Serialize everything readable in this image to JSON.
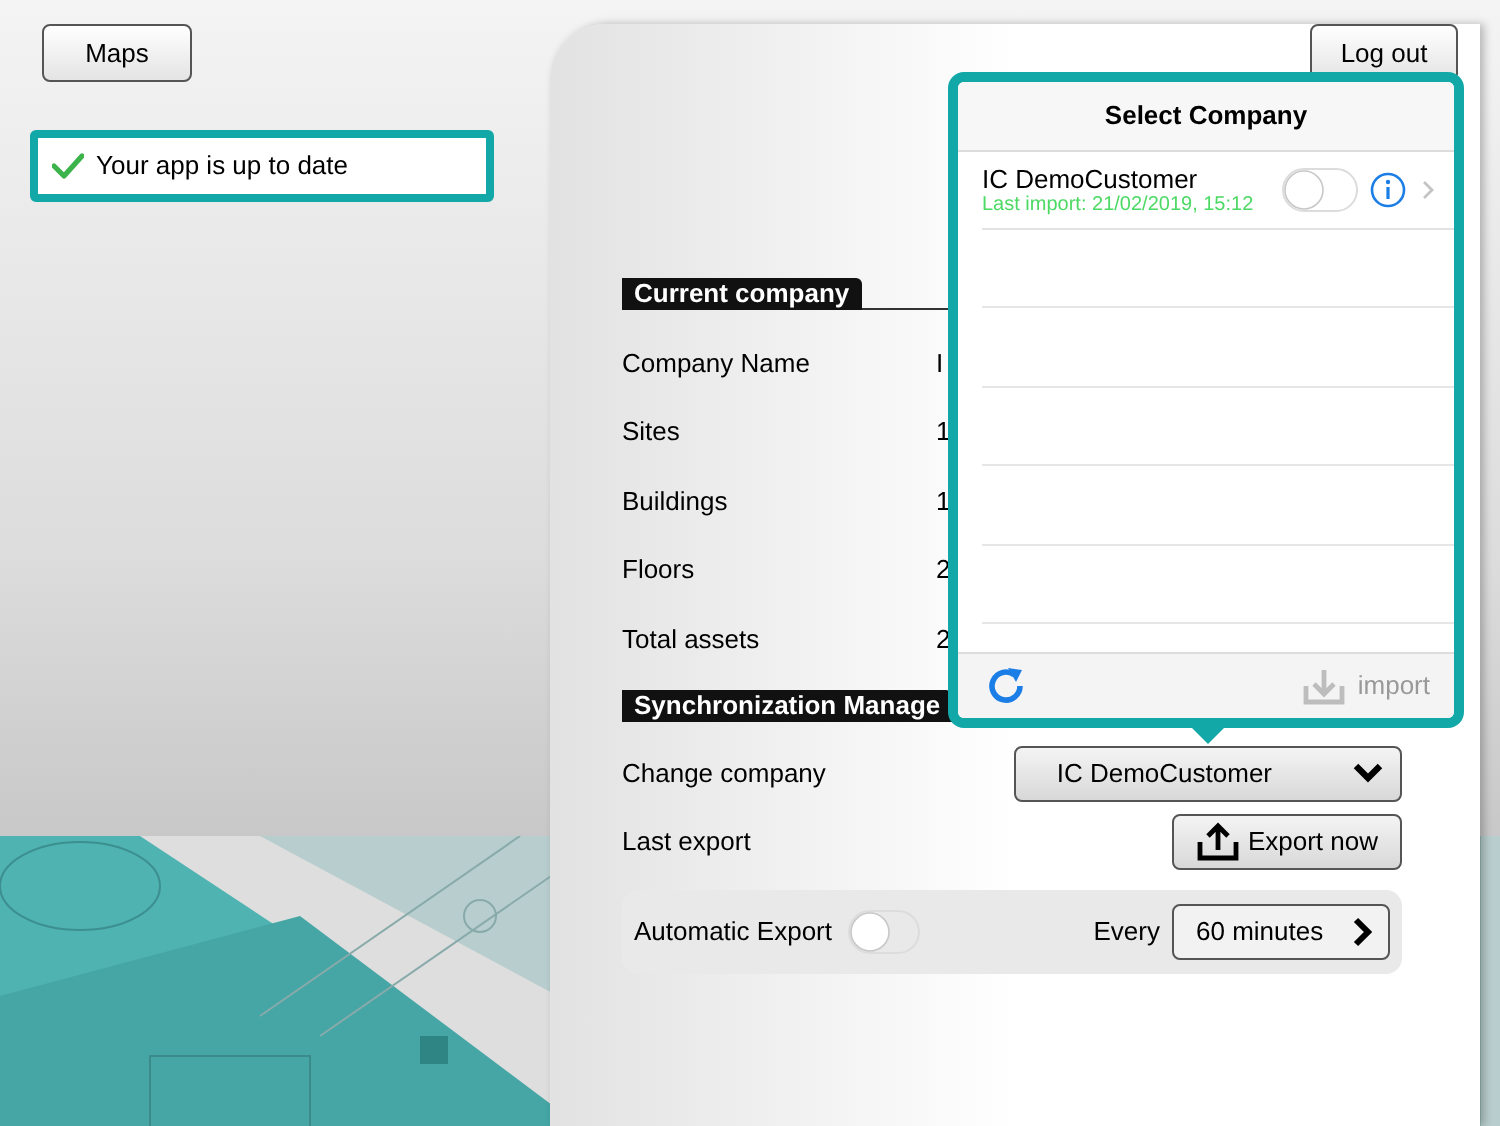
{
  "top_bar": {
    "maps_button": "Maps",
    "logout_button": "Log out"
  },
  "update_banner": {
    "text": "Your app is up to date"
  },
  "current_company": {
    "header": "Current company",
    "rows": [
      {
        "label": "Company Name",
        "value": "I"
      },
      {
        "label": "Sites",
        "value": "1"
      },
      {
        "label": "Buildings",
        "value": "1"
      },
      {
        "label": "Floors",
        "value": "2"
      },
      {
        "label": "Total assets",
        "value": "2"
      }
    ]
  },
  "synchronization": {
    "header": "Synchronization Manage",
    "change_company": {
      "label": "Change company",
      "value": "IC DemoCustomer"
    },
    "last_export": {
      "label": "Last export",
      "button": "Export now"
    },
    "automatic_export": {
      "label": "Automatic Export",
      "on": false,
      "every_label": "Every",
      "interval": "60 minutes"
    }
  },
  "popover": {
    "title": "Select Company",
    "companies": [
      {
        "name": "IC DemoCustomer",
        "last_import": "Last import: 21/02/2019, 15:12",
        "on": false
      }
    ],
    "import_button": {
      "label": "import",
      "disabled": true
    }
  }
}
